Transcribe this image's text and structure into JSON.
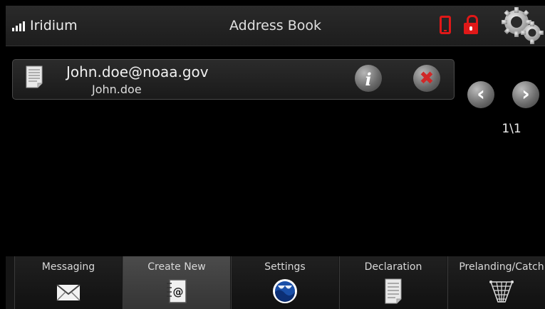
{
  "topbar": {
    "network": "Iridium",
    "title": "Address Book",
    "icons": [
      "signal-icon",
      "phone-status-icon",
      "unlocked-icon",
      "settings-gear-icon"
    ],
    "alert_color": "#e01818"
  },
  "contacts": [
    {
      "email": "John.doe@noaa.gov",
      "name": "John.doe",
      "icons": [
        "document-icon",
        "info-icon",
        "delete-icon"
      ]
    }
  ],
  "pager": {
    "prev_icon": "chevron-left-icon",
    "next_icon": "chevron-right-icon",
    "indicator": "1\\1"
  },
  "bottom_tabs": [
    {
      "label": "Messaging",
      "icon": "envelope-icon",
      "active": false
    },
    {
      "label": "Create New",
      "icon": "address-book-icon",
      "active": true
    },
    {
      "label": "Settings",
      "icon": "noaa-logo-icon",
      "active": false
    },
    {
      "label": "Declaration",
      "icon": "document-icon",
      "active": false
    },
    {
      "label": "Prelanding/Catch",
      "icon": "net-icon",
      "active": false
    }
  ],
  "glyphs": {
    "info": "i",
    "delete": "✖",
    "prev": "‹",
    "next": "›"
  }
}
